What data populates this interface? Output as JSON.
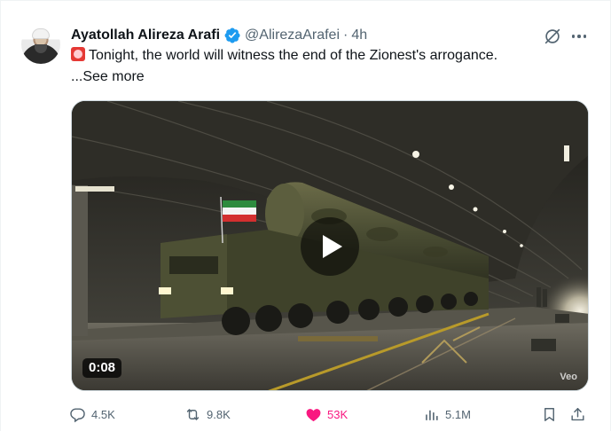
{
  "tweet": {
    "author_name": "Ayatollah Alireza Arafi",
    "handle": "@AlirezaArafei",
    "separator": "·",
    "time": "4h",
    "text": "Tonight, the world will witness the end of the Zionest's arrogance.",
    "emoji_icon": "rotating-light-icon",
    "see_more": "...See more"
  },
  "media": {
    "duration": "0:08",
    "watermark": "Veo",
    "play_icon": "play-icon"
  },
  "actions": {
    "replies": "4.5K",
    "reposts": "9.8K",
    "likes": "53K",
    "views": "5.1M"
  },
  "colors": {
    "verified_blue": "#1d9bf0",
    "like_pink": "#f91880",
    "secondary_text": "#536471"
  }
}
